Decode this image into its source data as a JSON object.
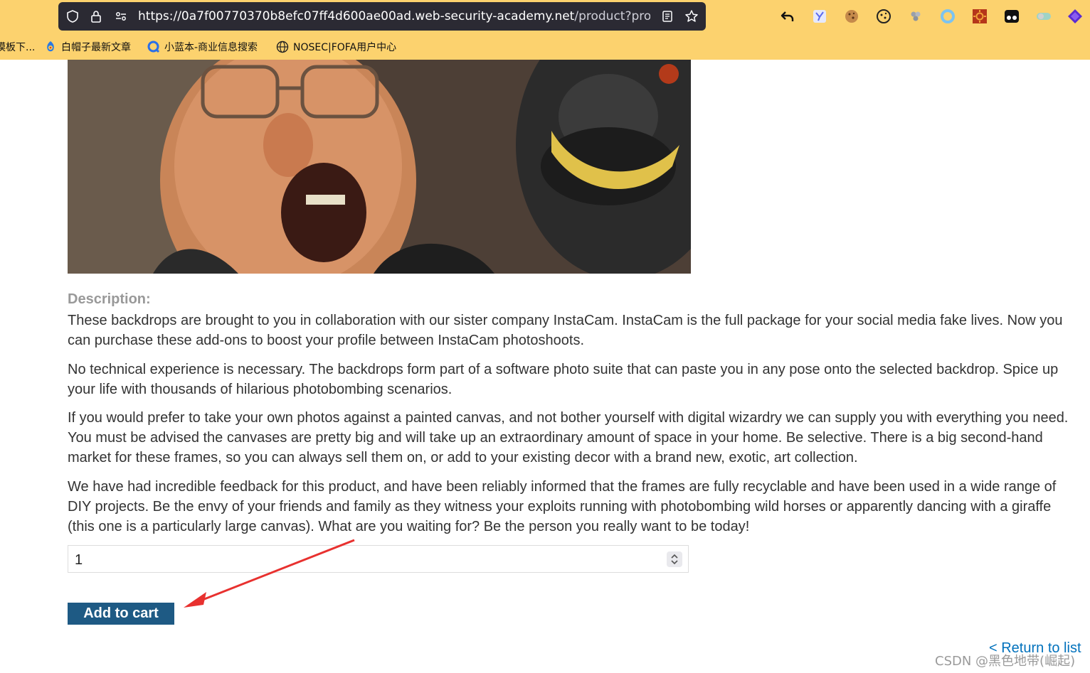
{
  "browser": {
    "url_host": "https://0a7f00770370b8efc07ff4d600ae00ad.web-security-academy.net",
    "url_path": "/product?produc"
  },
  "bookmarks": [
    {
      "label": "模板下..."
    },
    {
      "label": "白帽子最新文章"
    },
    {
      "label": "小蓝本-商业信息搜索"
    },
    {
      "label": "NOSEC|FOFA用户中心"
    }
  ],
  "product": {
    "description_label": "Description:",
    "paragraphs": [
      "These backdrops are brought to you in collaboration with our sister company InstaCam. InstaCam is the full package for your social media fake lives. Now you can purchase these add-ons to boost your profile between InstaCam photoshoots.",
      "No technical experience is necessary. The backdrops form part of a software photo suite that can paste you in any pose onto the selected backdrop. Spice up your life with thousands of hilarious photobombing scenarios.",
      "If you would prefer to take your own photos against a painted canvas, and not bother yourself with digital wizardry we can supply you with everything you need. You must be advised the canvases are pretty big and will take up an extraordinary amount of space in your home. Be selective. There is a big second-hand market for these frames, so you can always sell them on, or add to your existing decor with a brand new, exotic, art collection.",
      "We have had incredible feedback for this product, and have been reliably informed that the frames are fully recyclable and have been used in a wide range of DIY projects. Be the envy of your friends and family as they witness your exploits running with photobombing wild horses or apparently dancing with a giraffe (this one is a particularly large canvas). What are you waiting for? Be the person you really want to be today!"
    ],
    "quantity_value": "1",
    "add_to_cart_label": "Add to cart",
    "return_label": "< Return to list"
  },
  "watermark": "CSDN @黑色地带(崛起)",
  "colors": {
    "chrome_bg": "#fcd26e",
    "button_bg": "#1e5a84",
    "link": "#0071bc",
    "annotation_arrow": "#e8312f"
  }
}
